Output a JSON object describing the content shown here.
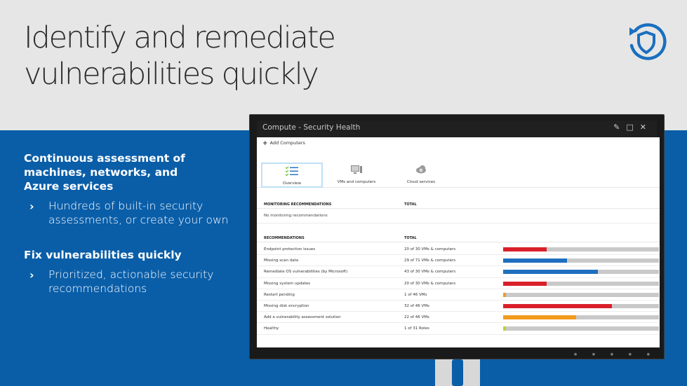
{
  "slide": {
    "title_lines": [
      "Identify and remediate",
      "vulnerabilities quickly"
    ],
    "logo_icon": "shield-refresh-icon",
    "colors": {
      "band_top": "#e6e6e6",
      "band_blue": "#0a5ea8",
      "logo_blue": "#1a6fbf"
    }
  },
  "sections": [
    {
      "heading_lines": [
        "Continuous assessment of",
        "machines, networks, and",
        "Azure services"
      ],
      "bullet_lines": [
        "Hundreds of built-in security",
        "assessments, or create your own"
      ]
    },
    {
      "heading_lines": [
        "Fix vulnerabilities quickly"
      ],
      "bullet_lines": [
        "Prioritized, actionable security",
        "recommendations"
      ]
    }
  ],
  "window": {
    "title": "Compute - Security Health",
    "controls": [
      "pin-icon",
      "maximize-icon",
      "close-icon"
    ],
    "command": "Add Computers",
    "tiles": [
      {
        "label": "Overview",
        "icon": "checklist-icon",
        "active": true
      },
      {
        "label": "VMs and computers",
        "icon": "computer-icon",
        "active": false
      },
      {
        "label": "Cloud services",
        "icon": "cloud-gear-icon",
        "active": false
      }
    ],
    "monitoring": {
      "col_name": "MONITORING RECOMMENDATIONS",
      "col_total": "TOTAL",
      "empty_text": "No monitoring recommendations"
    },
    "recommendations": {
      "col_name": "RECOMMENDATIONS",
      "col_total": "TOTAL",
      "rows": [
        {
          "name": "Endpoint protection issues",
          "total": "20 of 30 VMs & computers",
          "fraction": 0.28,
          "color": "#d9202a"
        },
        {
          "name": "Missing scan data",
          "total": "29 of 71 VMs & computers",
          "fraction": 0.41,
          "color": "#1f6fbf"
        },
        {
          "name": "Remediate OS vulnerabilities (by Microsoft)",
          "total": "43 of 30 VMs & computers",
          "fraction": 0.61,
          "color": "#1f6fbf"
        },
        {
          "name": "Missing system updates",
          "total": "20 of 30 VMs & computers",
          "fraction": 0.28,
          "color": "#d9202a"
        },
        {
          "name": "Restart pending",
          "total": "1 of 46 VMs",
          "fraction": 0.02,
          "color": "#f29a1f"
        },
        {
          "name": "Missing disk encryption",
          "total": "32 of 46 VMs",
          "fraction": 0.7,
          "color": "#d9202a"
        },
        {
          "name": "Add a vulnerability assessment solution",
          "total": "22 of 46 VMs",
          "fraction": 0.47,
          "color": "#f29a1f"
        },
        {
          "name": "Healthy",
          "total": "1 of 31 Roles",
          "fraction": 0.02,
          "color": "#b8d430"
        }
      ]
    }
  }
}
